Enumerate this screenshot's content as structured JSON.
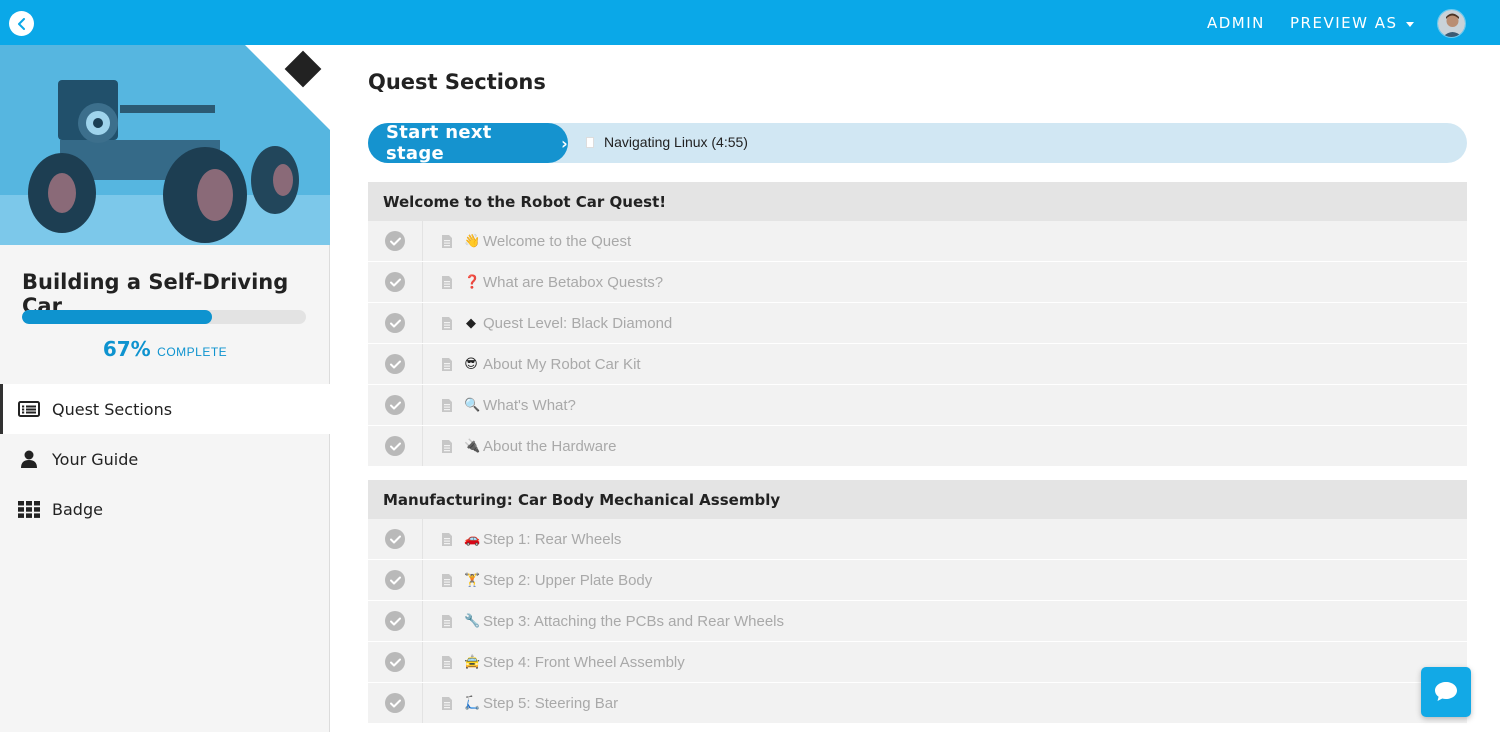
{
  "topbar": {
    "admin_label": "ADMIN",
    "preview_label": "PREVIEW AS",
    "accent_color": "#0aa8e8"
  },
  "sidebar": {
    "quest_title": "Building a Self-Driving Car",
    "progress": {
      "percent_value": 67,
      "percent_text": "67%",
      "complete_label": "COMPLETE"
    },
    "nav": [
      {
        "label": "Quest Sections",
        "icon": "list-icon",
        "active": true
      },
      {
        "label": "Your Guide",
        "icon": "user-icon",
        "active": false
      },
      {
        "label": "Badge",
        "icon": "grid-icon",
        "active": false
      }
    ]
  },
  "main": {
    "title": "Quest Sections",
    "next_stage": {
      "button_label": "Start next stage",
      "button_chevron": "›",
      "stage_title": "Navigating Linux (4:55)"
    },
    "sections": [
      {
        "title": "Welcome to the Robot Car Quest!",
        "items": [
          {
            "emoji": "👋",
            "title": "Welcome to the Quest"
          },
          {
            "emoji": "❓",
            "title": "What are Betabox Quests?"
          },
          {
            "emoji": "◆",
            "title": "Quest Level: Black Diamond"
          },
          {
            "emoji": "😎",
            "title": "About My Robot Car Kit"
          },
          {
            "emoji": "🔍",
            "title": "What's What?"
          },
          {
            "emoji": "🔌",
            "title": "About the Hardware"
          }
        ]
      },
      {
        "title": "Manufacturing: Car Body Mechanical Assembly",
        "items": [
          {
            "emoji": "🚗",
            "title": "Step 1: Rear Wheels"
          },
          {
            "emoji": "🏋",
            "title": "Step 2: Upper Plate Body"
          },
          {
            "emoji": "🔧",
            "title": "Step 3: Attaching the PCBs and Rear Wheels"
          },
          {
            "emoji": "🚖",
            "title": "Step 4: Front Wheel Assembly"
          },
          {
            "emoji": "🛴",
            "title": "Step 5: Steering Bar"
          }
        ]
      }
    ]
  }
}
